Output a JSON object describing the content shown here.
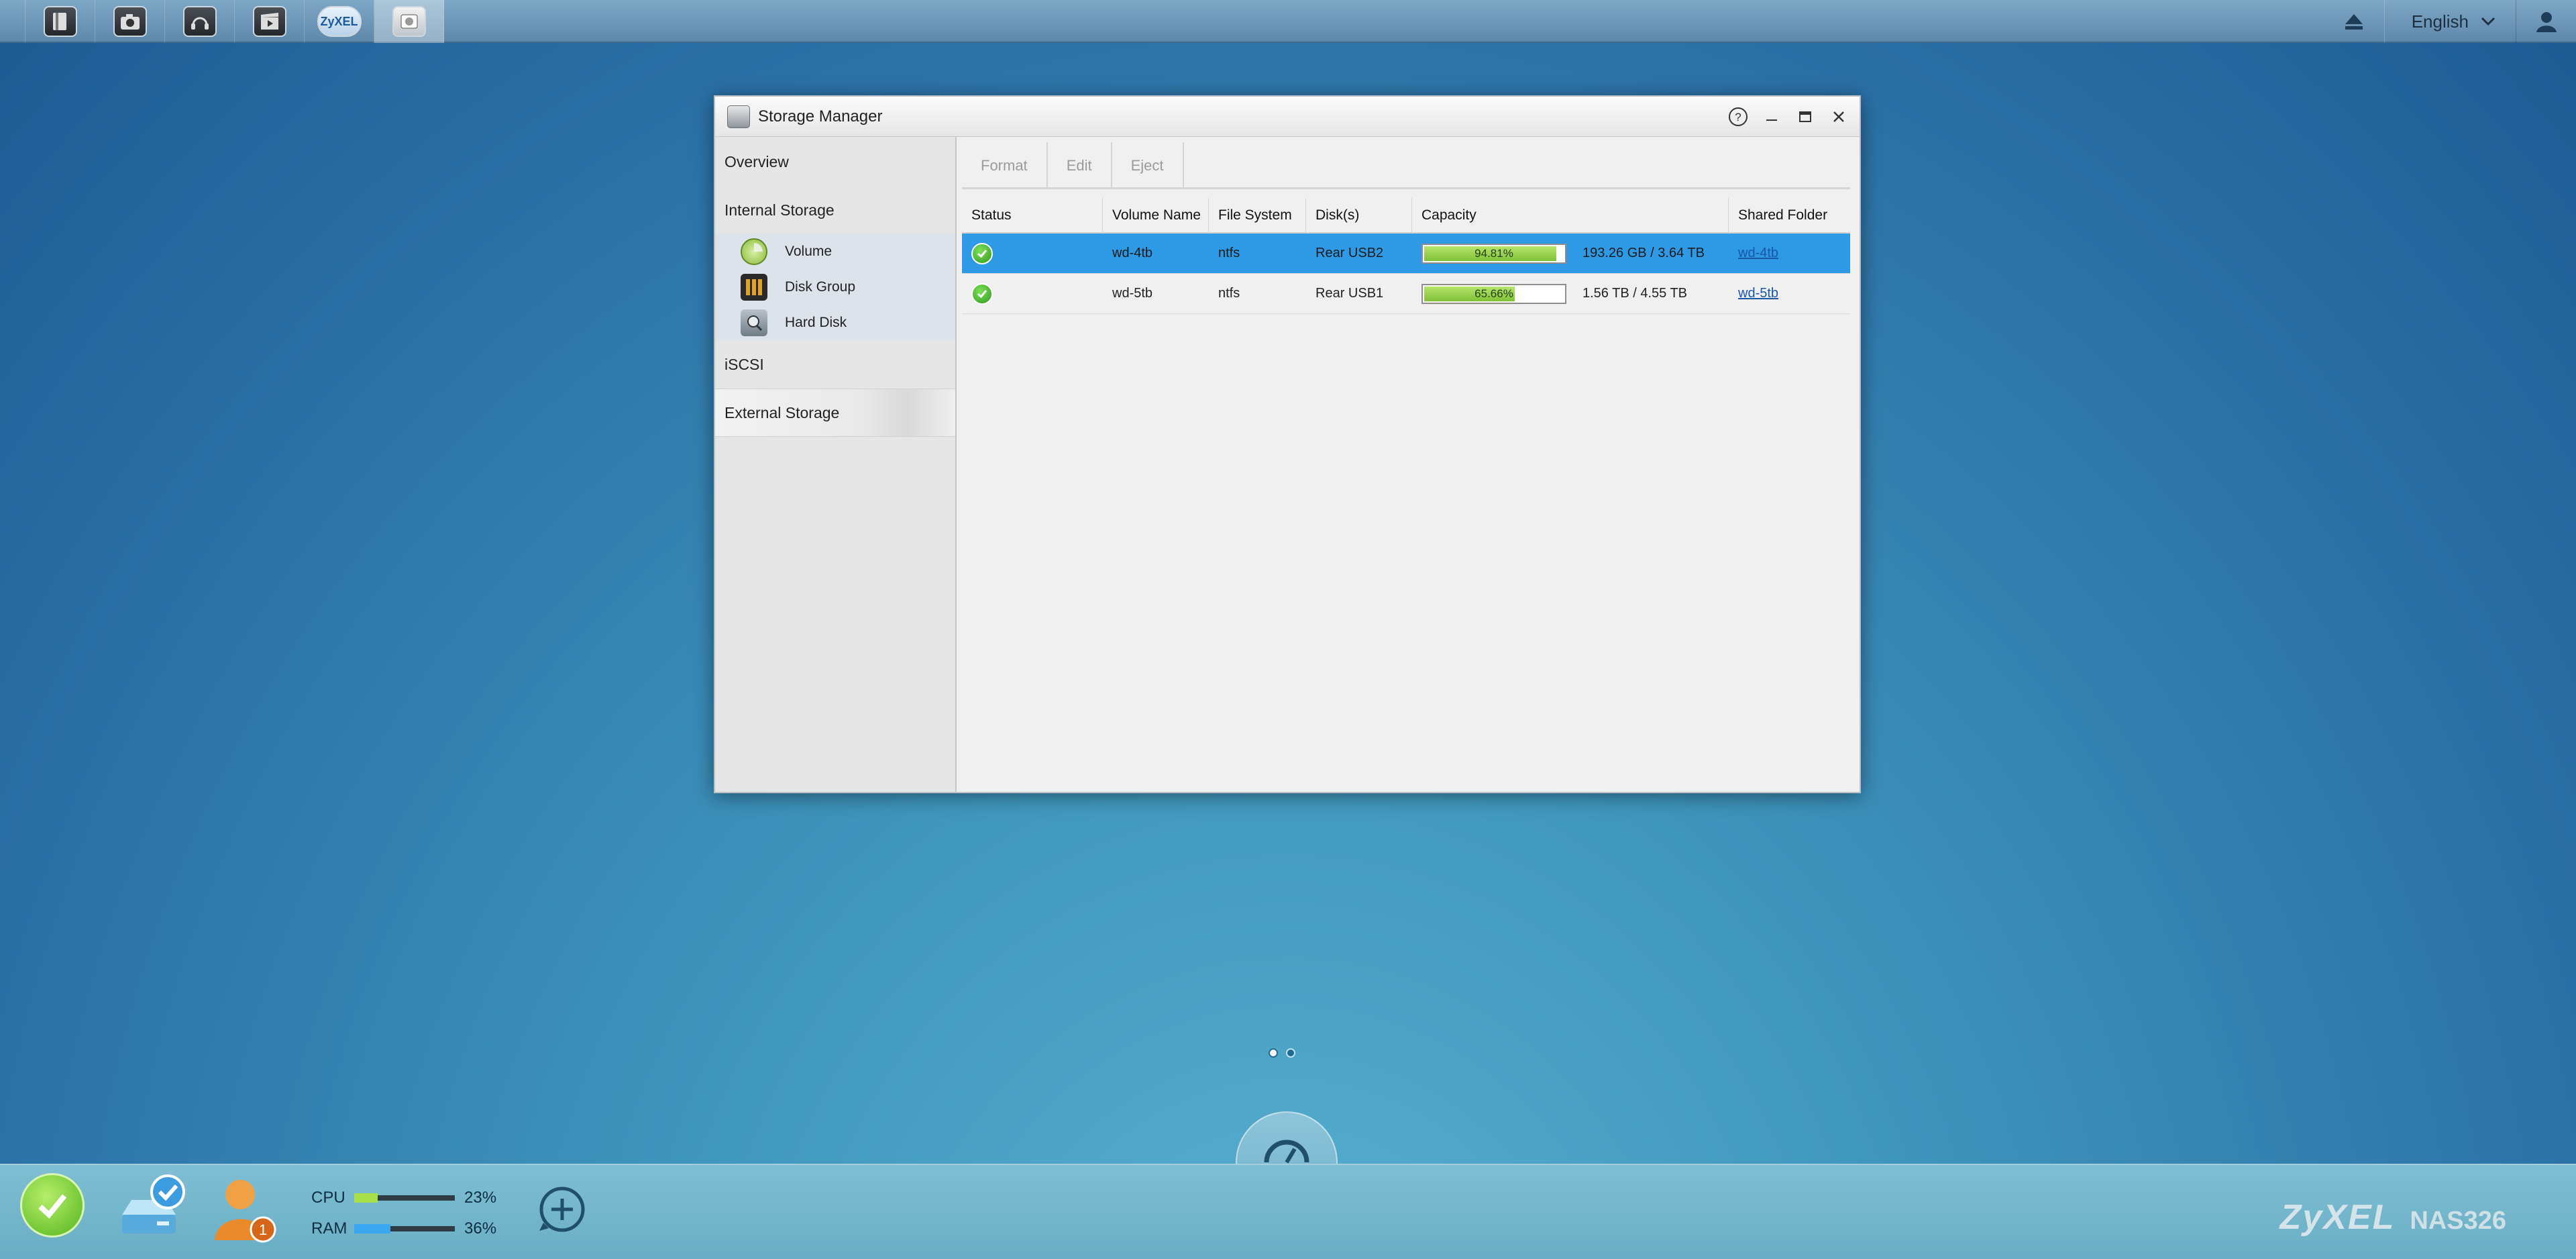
{
  "topbar": {
    "apps": [
      {
        "name": "file-browser",
        "glyph": "▮"
      },
      {
        "name": "photo",
        "glyph": "◉"
      },
      {
        "name": "music",
        "glyph": "♫"
      },
      {
        "name": "video",
        "glyph": "▶"
      },
      {
        "name": "zyxel-cloud",
        "glyph": "ZyXEL"
      },
      {
        "name": "storage-manager",
        "glyph": "▤"
      }
    ],
    "language": "English"
  },
  "window": {
    "title": "Storage Manager",
    "sidebar": {
      "overview": "Overview",
      "internal_storage": "Internal Storage",
      "sub_items": [
        {
          "label": "Volume"
        },
        {
          "label": "Disk Group"
        },
        {
          "label": "Hard Disk"
        }
      ],
      "iscsi": "iSCSI",
      "external_storage": "External Storage"
    },
    "toolbar": {
      "format": "Format",
      "edit": "Edit",
      "eject": "Eject"
    },
    "table": {
      "headers": [
        "Status",
        "Volume Name",
        "File System",
        "Disk(s)",
        "Capacity",
        "Shared Folder"
      ],
      "rows": [
        {
          "volume_name": "wd-4tb",
          "file_system": "ntfs",
          "disks": "Rear USB2",
          "usage_pct": 94.81,
          "usage_label": "94.81%",
          "capacity": "193.26 GB / 3.64 TB",
          "shared_folder": "wd-4tb",
          "selected": true
        },
        {
          "volume_name": "wd-5tb",
          "file_system": "ntfs",
          "disks": "Rear USB1",
          "usage_pct": 65.66,
          "usage_label": "65.66%",
          "capacity": "1.56 TB / 4.55 TB",
          "shared_folder": "wd-5tb",
          "selected": false
        }
      ]
    }
  },
  "pager": {
    "pages": 2,
    "current": 1
  },
  "bottombar": {
    "cpu_label": "CPU",
    "cpu_value": "23%",
    "cpu_pct": 23,
    "ram_label": "RAM",
    "ram_value": "36%",
    "ram_pct": 36,
    "notification_count": "1",
    "brand": "ZyXEL",
    "model": "NAS326",
    "colors": {
      "cpu_fill": "#a8e04a",
      "ram_fill": "#3aa7f0",
      "selected_row": "#2e9ae6"
    }
  }
}
